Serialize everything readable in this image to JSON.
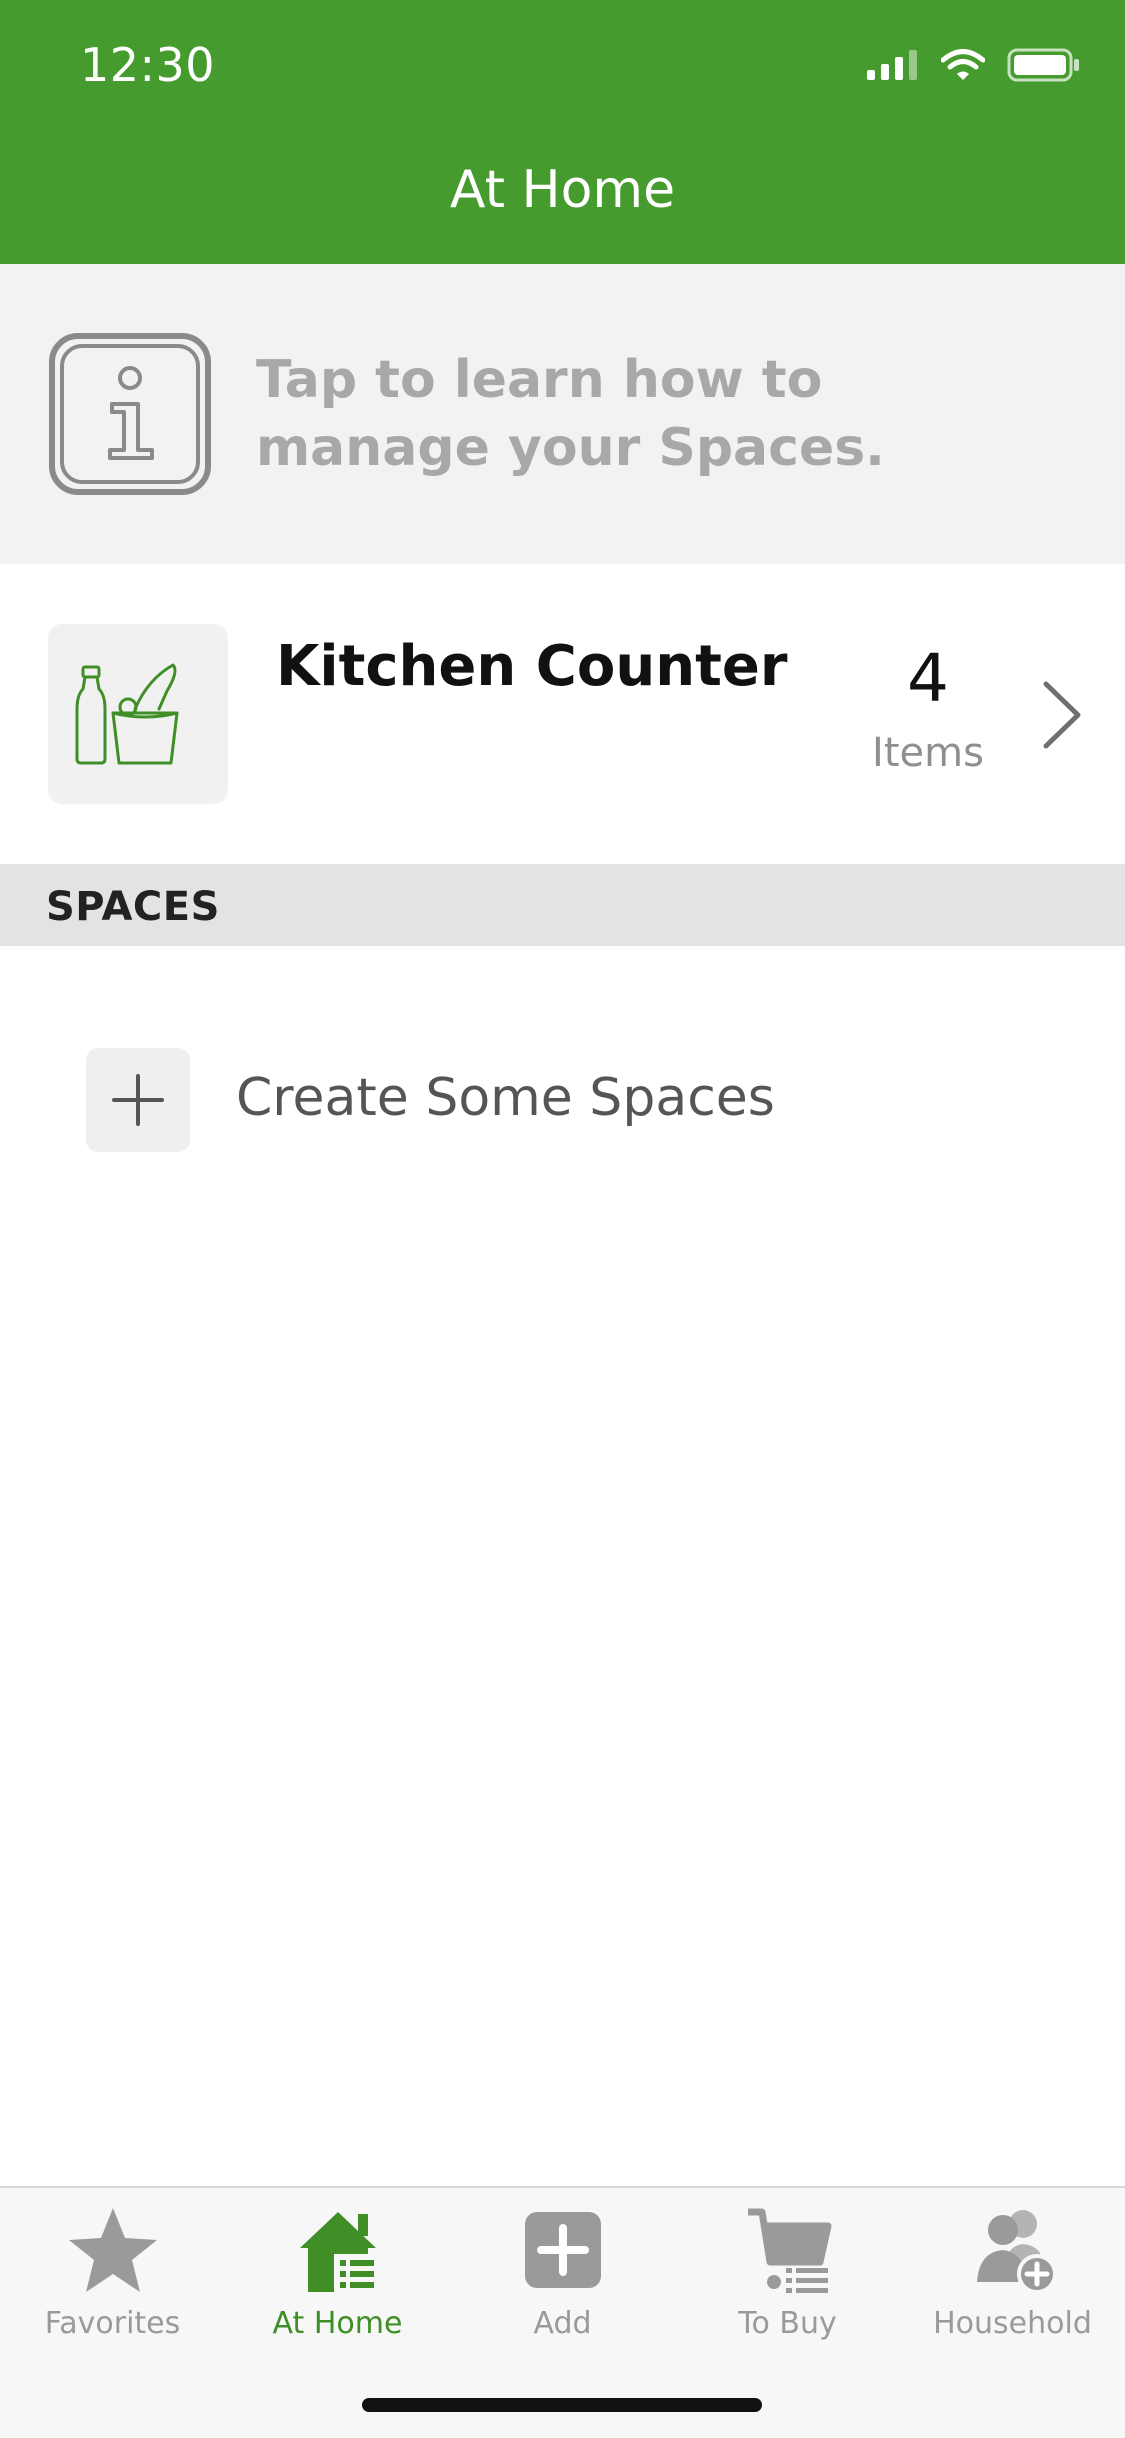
{
  "status_bar": {
    "time": "12:30"
  },
  "header": {
    "title": "At Home"
  },
  "info_banner": {
    "text": "Tap to learn how to manage your Spaces."
  },
  "space": {
    "name": "Kitchen Counter",
    "count": "4",
    "count_label": "Items"
  },
  "section": {
    "title": "SPACES"
  },
  "create": {
    "label": "Create Some Spaces"
  },
  "tabs": [
    {
      "label": "Favorites",
      "icon": "star-icon"
    },
    {
      "label": "At Home",
      "icon": "home-list-icon"
    },
    {
      "label": "Add",
      "icon": "add-icon"
    },
    {
      "label": "To Buy",
      "icon": "cart-icon"
    },
    {
      "label": "Household",
      "icon": "household-add-icon"
    }
  ],
  "colors": {
    "brand_green": "#469b2e",
    "active_tab": "#3f8f26",
    "inactive_tab": "#9a9a9a"
  }
}
